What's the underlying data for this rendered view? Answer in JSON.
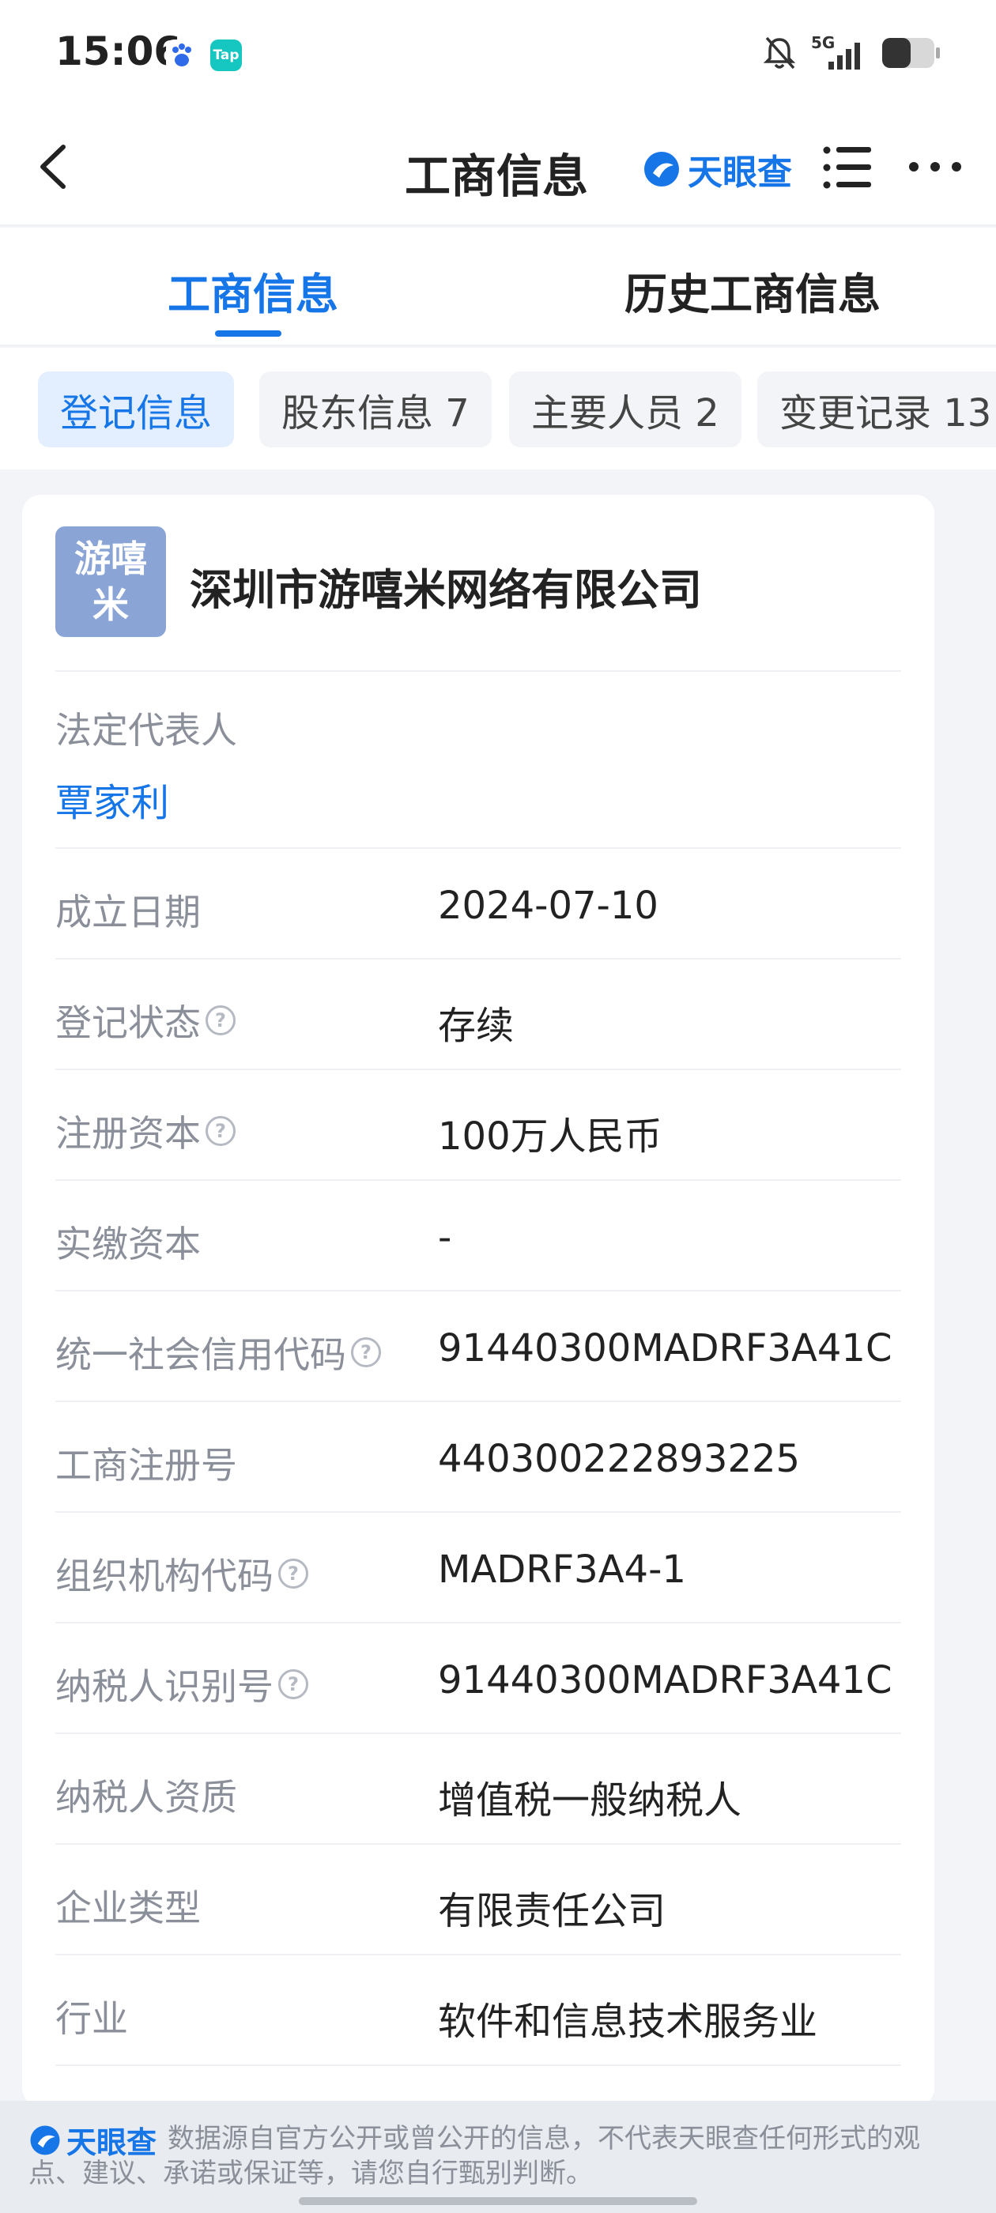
{
  "status_bar": {
    "time": "15:06",
    "tap_badge": "Tap",
    "network": "5G"
  },
  "nav": {
    "title": "工商信息",
    "brand": "天眼查"
  },
  "tabs": [
    {
      "label": "工商信息",
      "active": true
    },
    {
      "label": "历史工商信息",
      "active": false
    }
  ],
  "chips": [
    {
      "label": "登记信息",
      "active": true
    },
    {
      "label": "股东信息 7",
      "active": false
    },
    {
      "label": "主要人员 2",
      "active": false
    },
    {
      "label": "变更记录 13",
      "active": false
    }
  ],
  "company": {
    "logo_line1": "游嘻",
    "logo_line2": "米",
    "name": "深圳市游嘻米网络有限公司",
    "logo_color": "#8aa4d6"
  },
  "legal_rep": {
    "label": "法定代表人",
    "value": "覃家利"
  },
  "rows": [
    {
      "label": "成立日期",
      "value": "2024-07-10",
      "help": false
    },
    {
      "label": "登记状态",
      "value": "存续",
      "help": true
    },
    {
      "label": "注册资本",
      "value": "100万人民币",
      "help": true
    },
    {
      "label": "实缴资本",
      "value": "-",
      "help": false
    },
    {
      "label": "统一社会信用代码",
      "value": "91440300MADRF3A41C",
      "help": true
    },
    {
      "label": "工商注册号",
      "value": "440300222893225",
      "help": false
    },
    {
      "label": "组织机构代码",
      "value": "MADRF3A4-1",
      "help": true
    },
    {
      "label": "纳税人识别号",
      "value": "91440300MADRF3A41C",
      "help": true
    },
    {
      "label": "纳税人资质",
      "value": "增值税一般纳税人",
      "help": false
    },
    {
      "label": "企业类型",
      "value": "有限责任公司",
      "help": false
    },
    {
      "label": "行业",
      "value": "软件和信息技术服务业",
      "help": false
    }
  ],
  "footer": {
    "brand": "天眼查",
    "disclaimer": "数据源自官方公开或曾公开的信息，不代表天眼查任何形式的观点、建议、承诺或保证等，请您自行甄别判断。"
  },
  "colors": {
    "accent": "#1676e8",
    "label_gray": "#8a8f99",
    "page_bg": "#f2f4f7"
  },
  "icons": [
    "baidu-app-icon",
    "tap-app-icon",
    "mute-bell-icon",
    "signal-icon",
    "battery-icon",
    "back-arrow-icon",
    "tianyancha-logo-icon",
    "list-icon",
    "more-icon",
    "help-circle-icon"
  ]
}
